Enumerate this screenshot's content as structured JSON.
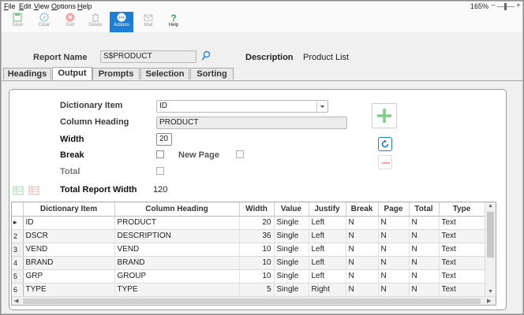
{
  "menu": [
    {
      "label": "File",
      "ul": "F"
    },
    {
      "label": "Edit",
      "ul": "E"
    },
    {
      "label": "View",
      "ul": "V"
    },
    {
      "label": "Options",
      "ul": "O"
    },
    {
      "label": "Help",
      "ul": "H"
    }
  ],
  "zoom": {
    "label": "165%",
    "minus": "−",
    "plus": "+"
  },
  "toolbar": {
    "save": "Save",
    "clear": "Clear",
    "exit": "Exit",
    "delete": "Delete",
    "actions": "Actions",
    "mail": "Mail",
    "help": "Help"
  },
  "report": {
    "name_label": "Report Name",
    "name_value": "S$PRODUCT",
    "description_label": "Description",
    "description_value": "Product List"
  },
  "tabs": [
    "Headings",
    "Output",
    "Prompts",
    "Selection",
    "Sorting"
  ],
  "active_tab": "Output",
  "form": {
    "dict_item_label": "Dictionary Item",
    "dict_item_value": "ID",
    "column_heading_label": "Column Heading",
    "column_heading_value": "PRODUCT",
    "width_label": "Width",
    "width_value": "20",
    "break_label": "Break",
    "new_page_label": "New Page",
    "total_label": "Total",
    "total_width_label": "Total Report Width",
    "total_width_value": "120"
  },
  "grid": {
    "columns": [
      "Dictionary Item",
      "Column Heading",
      "Width",
      "Value",
      "Justify",
      "Break",
      "Page",
      "Total",
      "Type"
    ],
    "rows": [
      {
        "hdr": "▸",
        "dict": "ID",
        "heading": "PRODUCT",
        "width": "20",
        "value": "Single",
        "justify": "Left",
        "brk": "N",
        "page": "N",
        "total": "N",
        "type": "Text"
      },
      {
        "hdr": "2",
        "dict": "DSCR",
        "heading": "DESCRIPTION",
        "width": "36",
        "value": "Single",
        "justify": "Left",
        "brk": "N",
        "page": "N",
        "total": "N",
        "type": "Text"
      },
      {
        "hdr": "3",
        "dict": "VEND",
        "heading": "VEND",
        "width": "10",
        "value": "Single",
        "justify": "Left",
        "brk": "N",
        "page": "N",
        "total": "N",
        "type": "Text"
      },
      {
        "hdr": "4",
        "dict": "BRAND",
        "heading": "BRAND",
        "width": "10",
        "value": "Single",
        "justify": "Left",
        "brk": "N",
        "page": "N",
        "total": "N",
        "type": "Text"
      },
      {
        "hdr": "5",
        "dict": "GRP",
        "heading": "GROUP",
        "width": "10",
        "value": "Single",
        "justify": "Left",
        "brk": "N",
        "page": "N",
        "total": "N",
        "type": "Text"
      },
      {
        "hdr": "6",
        "dict": "TYPE",
        "heading": "TYPE",
        "width": "5",
        "value": "Single",
        "justify": "Right",
        "brk": "N",
        "page": "N",
        "total": "N",
        "type": "Text"
      }
    ]
  },
  "colors": {
    "accent": "#1d7ed6",
    "add_green": "#7fcf8a",
    "refresh_blue": "#1d7ed6",
    "remove_red": "#f3a3a3"
  }
}
